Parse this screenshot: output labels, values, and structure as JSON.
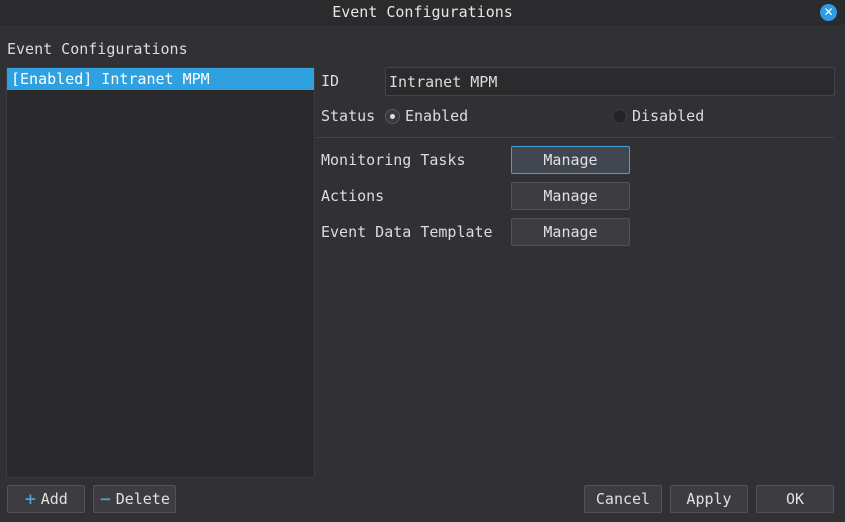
{
  "window": {
    "title": "Event Configurations",
    "close_icon": "close-icon"
  },
  "left": {
    "section_label": "Event Configurations",
    "items": [
      {
        "label": "[Enabled] Intranet MPM",
        "selected": true
      }
    ],
    "add_label": "Add",
    "add_icon": "plus-icon",
    "delete_label": "Delete",
    "delete_icon": "minus-icon"
  },
  "form": {
    "id_label": "ID",
    "id_value": "Intranet MPM",
    "status_label": "Status",
    "status_enabled": "Enabled",
    "status_disabled": "Disabled",
    "status_selected": "Enabled",
    "monitoring_label": "Monitoring Tasks",
    "actions_label": "Actions",
    "template_label": "Event Data Template",
    "manage_label": "Manage"
  },
  "footer": {
    "cancel": "Cancel",
    "apply": "Apply",
    "ok": "OK"
  },
  "colors": {
    "accent": "#2fa1e0",
    "background": "#313135",
    "panel": "#2a2a2d"
  }
}
